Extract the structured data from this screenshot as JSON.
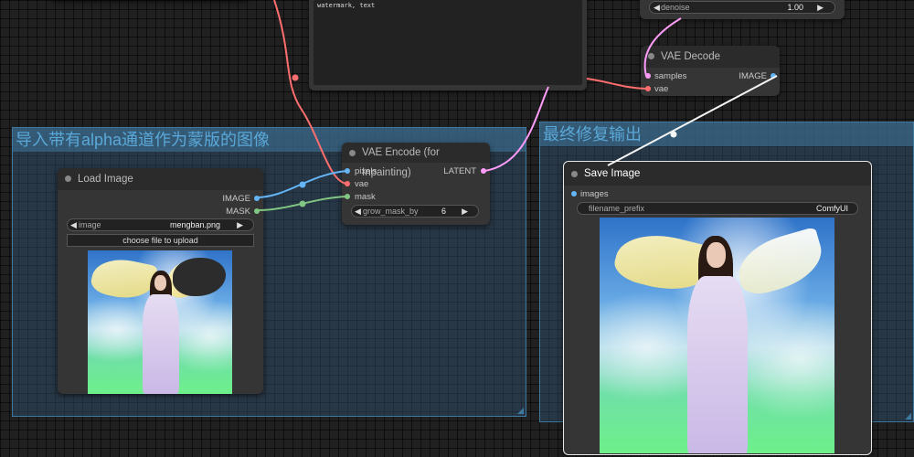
{
  "canvas": {
    "top_widget": {
      "name": "denoise",
      "value": "1.00"
    },
    "text_node_text": "watermark, text"
  },
  "groups": {
    "left_title": "导入带有alpha通道作为蒙版的图像",
    "right_title": "最终修复输出"
  },
  "load_image": {
    "title": "Load Image",
    "outputs": [
      "IMAGE",
      "MASK"
    ],
    "image_widget": {
      "name": "image",
      "value": "mengban.png"
    },
    "upload_button": "choose file to upload"
  },
  "vae_encode": {
    "title": "VAE Encode (for Inpainting)",
    "inputs": [
      "pixels",
      "vae",
      "mask"
    ],
    "output": "LATENT",
    "grow_widget": {
      "name": "grow_mask_by",
      "value": "6"
    }
  },
  "vae_decode": {
    "title": "VAE Decode",
    "inputs": [
      "samples",
      "vae"
    ],
    "output": "IMAGE"
  },
  "save_image": {
    "title": "Save Image",
    "input": "images",
    "prefix_widget": {
      "name": "filename_prefix",
      "value": "ComfyUI"
    }
  },
  "colors": {
    "image_link": "#64b5f6",
    "mask_link": "#81c784",
    "vae_link": "#ff6e6e",
    "latent_link": "#ff9cf9",
    "group_title": "#5aa8d8"
  }
}
